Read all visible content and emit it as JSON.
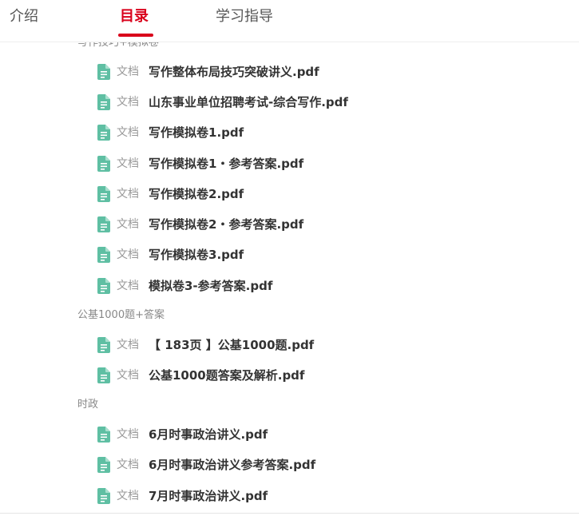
{
  "tabs": [
    {
      "label": "介绍",
      "active": false
    },
    {
      "label": "目录",
      "active": true
    },
    {
      "label": "学习指导",
      "active": false
    }
  ],
  "colors": {
    "accent": "#d9001b",
    "doc_icon": "#5fbfa3"
  },
  "icons": {
    "document": "document-icon"
  },
  "sections": [
    {
      "title": "写作技巧+模拟卷",
      "items": [
        {
          "type": "文档",
          "title": "写作整体布局技巧突破讲义.pdf"
        },
        {
          "type": "文档",
          "title": "山东事业单位招聘考试-综合写作.pdf"
        },
        {
          "type": "文档",
          "title": "写作模拟卷1.pdf"
        },
        {
          "type": "文档",
          "title": "写作模拟卷1・参考答案.pdf"
        },
        {
          "type": "文档",
          "title": "写作模拟卷2.pdf"
        },
        {
          "type": "文档",
          "title": "写作模拟卷2・参考答案.pdf"
        },
        {
          "type": "文档",
          "title": "写作模拟卷3.pdf"
        },
        {
          "type": "文档",
          "title": "模拟卷3-参考答案.pdf"
        }
      ]
    },
    {
      "title": "公基1000题+答案",
      "items": [
        {
          "type": "文档",
          "title": "【 183页 】公基1000题.pdf"
        },
        {
          "type": "文档",
          "title": "公基1000题答案及解析.pdf"
        }
      ]
    },
    {
      "title": "时政",
      "items": [
        {
          "type": "文档",
          "title": "6月时事政治讲义.pdf"
        },
        {
          "type": "文档",
          "title": "6月时事政治讲义参考答案.pdf"
        },
        {
          "type": "文档",
          "title": "7月时事政治讲义.pdf"
        }
      ]
    }
  ]
}
